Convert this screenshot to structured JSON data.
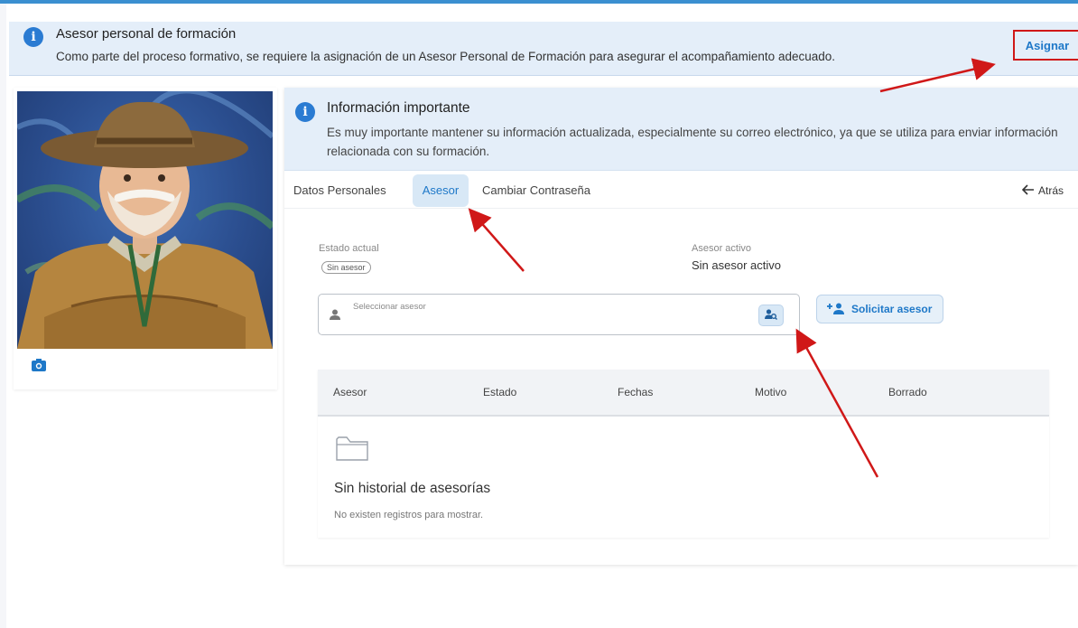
{
  "banner": {
    "title": "Asesor personal de formación",
    "text": "Como parte del proceso formativo, se requiere la asignación de un Asesor Personal de Formación para asegurar el acompañamiento adecuado.",
    "assign_label": "Asignar"
  },
  "info": {
    "title": "Información importante",
    "text": "Es muy importante mantener su información actualizada, especialmente su correo electrónico, ya que se utiliza para enviar información relacionada con su formación."
  },
  "tabs": [
    {
      "label": "Datos Personales"
    },
    {
      "label": "Asesor",
      "active": true
    },
    {
      "label": "Cambiar Contraseña"
    }
  ],
  "back_label": "Atrás",
  "advisor": {
    "estado_label": "Estado actual",
    "estado_value": "Sin asesor",
    "activo_label": "Asesor activo",
    "activo_value": "Sin asesor activo",
    "select_placeholder": "Seleccionar asesor",
    "solicitar_label": "Solicitar asesor"
  },
  "history": {
    "columns": [
      "Asesor",
      "Estado",
      "Fechas",
      "Motivo",
      "Borrado"
    ],
    "empty_title": "Sin historial de asesorías",
    "empty_text": "No existen registros para mostrar."
  },
  "colors": {
    "accent": "#1e78c8",
    "info_bg": "#e4eef9",
    "annotation_red": "#d01818"
  },
  "icons": [
    "info-icon",
    "camera-icon",
    "person-icon",
    "person-search-icon",
    "person-add-icon",
    "arrow-left-icon",
    "folder-icon"
  ]
}
